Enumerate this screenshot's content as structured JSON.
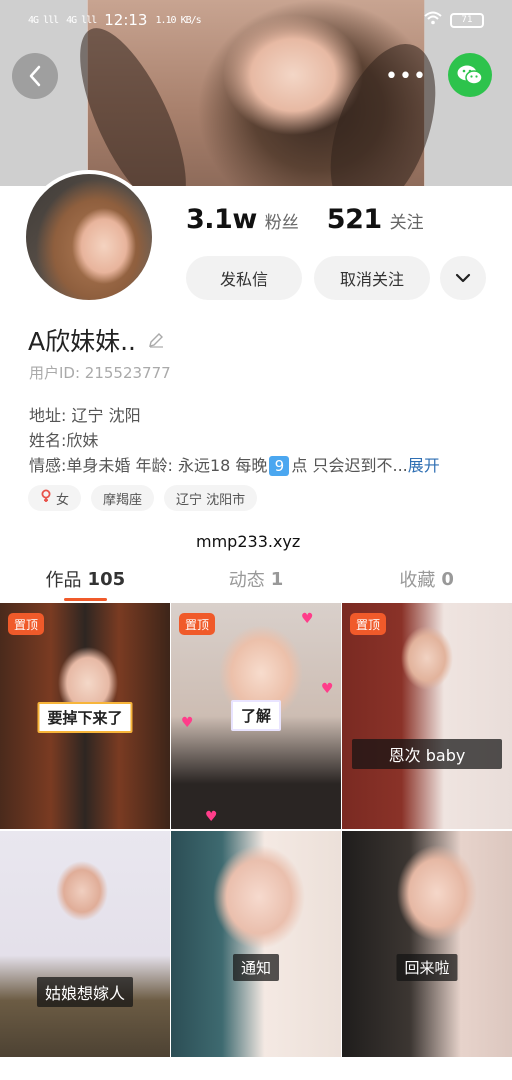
{
  "status_bar": {
    "signal_1": "4G lll",
    "signal_2": "4G lll",
    "time": "12:13",
    "speed": "1.10 KB/s",
    "battery": "71"
  },
  "header": {
    "back_icon": "chevron-left-icon",
    "more_icon": "more-dots-icon",
    "more_label": "•••",
    "share_icon": "wechat-icon"
  },
  "profile": {
    "followers_count": "3.1w",
    "followers_label": "粉丝",
    "following_count": "521",
    "following_label": "关注",
    "message_button": "发私信",
    "unfollow_button": "取消关注",
    "nickname": "A欣妹妹..",
    "user_id": "用户ID: 215523777",
    "address": "地址: 辽宁 沈阳",
    "name": "姓名:欣妹",
    "status_pre": "情感:单身未婚 年龄: 永远18 每晚",
    "status_num": "9",
    "status_post": "点 只会迟到不...",
    "expand_link": "展开",
    "tags": {
      "gender": "女",
      "zodiac": "摩羯座",
      "city": "辽宁 沈阳市"
    }
  },
  "watermark": "mmp233.xyz",
  "tabs": [
    {
      "label": "作品",
      "count": "105"
    },
    {
      "label": "动态",
      "count": "1"
    },
    {
      "label": "收藏",
      "count": "0"
    }
  ],
  "posts": [
    {
      "pinned": "置顶",
      "caption": "要掉下来了"
    },
    {
      "pinned": "置顶",
      "caption": "了解"
    },
    {
      "pinned": "置顶",
      "caption": "恩次 baby"
    },
    {
      "caption": "姑娘想嫁人"
    },
    {
      "caption": "通知"
    },
    {
      "caption": "回来啦"
    }
  ],
  "colors": {
    "accent": "#f05a2a",
    "wechat": "#2dc34c",
    "link": "#2f6fb3"
  }
}
